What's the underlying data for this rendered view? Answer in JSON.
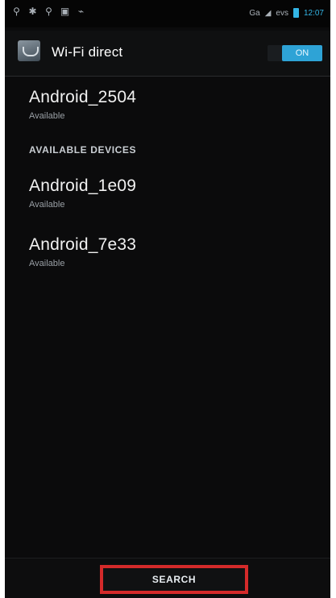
{
  "statusbar": {
    "left_icons": [
      "usb-icon",
      "android-icon",
      "usb-icon",
      "image-icon",
      "alarm-icon"
    ],
    "network": "Ga",
    "signal_text": "evs",
    "clock": "12:07"
  },
  "actionbar": {
    "title": "Wi-Fi direct",
    "toggle_label": "ON"
  },
  "devices": {
    "paired": [
      {
        "name": "Android_2504",
        "status": "Available"
      }
    ],
    "section_header": "AVAILABLE DEVICES",
    "available": [
      {
        "name": "Android_1e09",
        "status": "Available"
      },
      {
        "name": "Android_7e33",
        "status": "Available"
      }
    ]
  },
  "bottom": {
    "search_label": "SEARCH"
  },
  "colors": {
    "accent": "#33b5e5",
    "highlight": "#d42a2a",
    "background": "#0b0b0c"
  }
}
